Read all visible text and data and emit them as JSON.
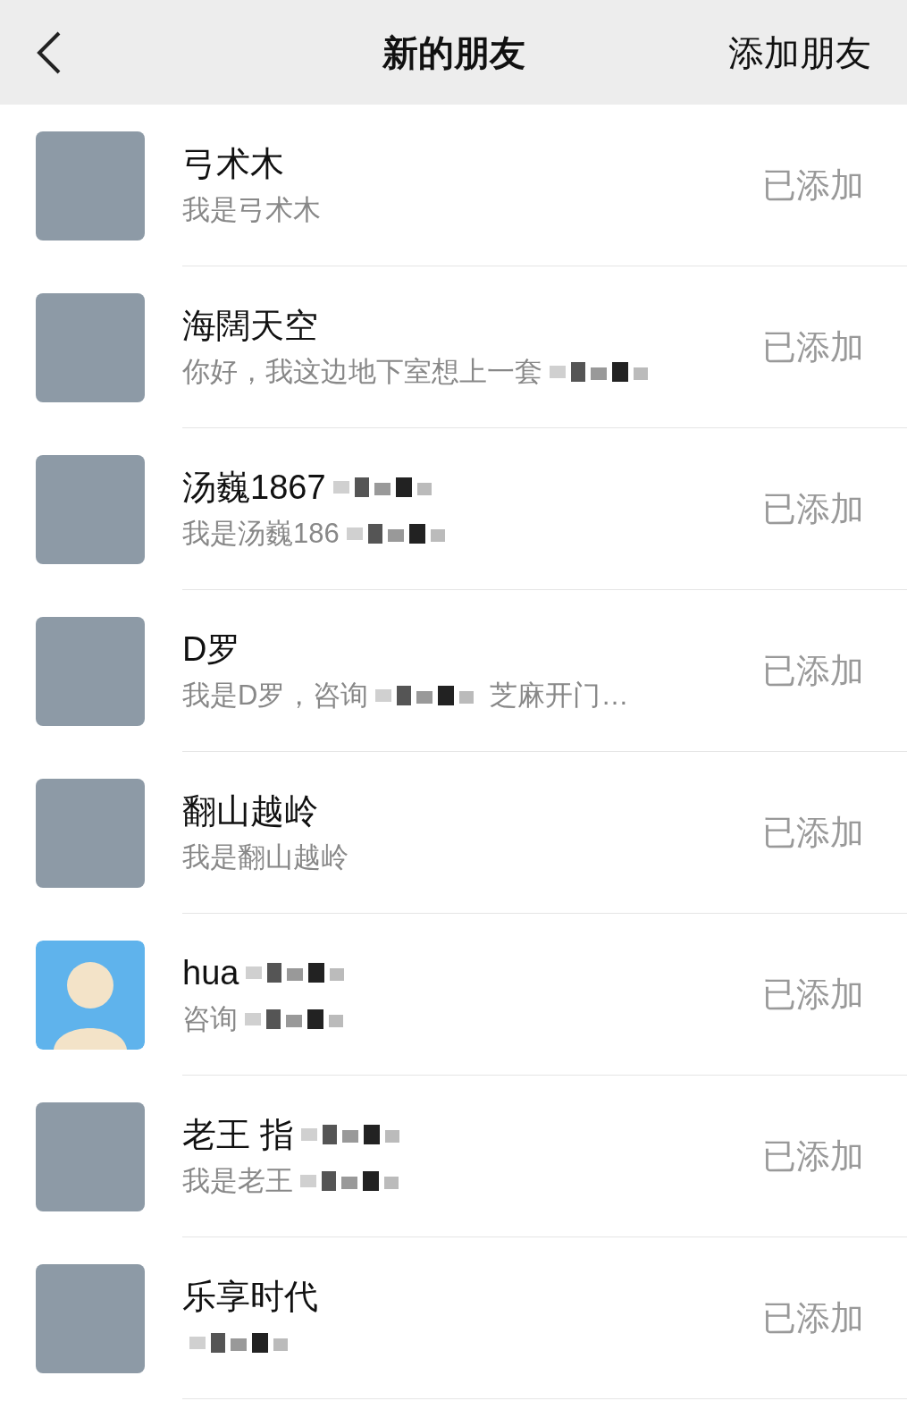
{
  "header": {
    "title": "新的朋友",
    "action": "添加朋友"
  },
  "items": [
    {
      "kind": "photo",
      "name": [
        {
          "kind": "text",
          "text": "弓术木"
        }
      ],
      "message": [
        {
          "kind": "text",
          "text": "我是弓术木"
        }
      ],
      "status": "已添加"
    },
    {
      "kind": "photo",
      "name": [
        {
          "kind": "text",
          "text": "海闊天空"
        }
      ],
      "message": [
        {
          "kind": "text",
          "text": "你好，我这边地下室想上一套"
        },
        {
          "kind": "mosaic"
        }
      ],
      "status": "已添加"
    },
    {
      "kind": "photo",
      "name": [
        {
          "kind": "text",
          "text": "汤巍1867"
        },
        {
          "kind": "mosaic"
        }
      ],
      "message": [
        {
          "kind": "text",
          "text": "我是汤巍186"
        },
        {
          "kind": "mosaic"
        }
      ],
      "status": "已添加"
    },
    {
      "kind": "photo",
      "name": [
        {
          "kind": "text",
          "text": "D罗"
        }
      ],
      "message": [
        {
          "kind": "text",
          "text": "我是D罗，咨询"
        },
        {
          "kind": "mosaic"
        },
        {
          "kind": "text",
          "text": "芝麻开门…"
        }
      ],
      "status": "已添加"
    },
    {
      "kind": "photo",
      "name": [
        {
          "kind": "text",
          "text": "翻山越岭"
        }
      ],
      "message": [
        {
          "kind": "text",
          "text": "我是翻山越岭"
        }
      ],
      "status": "已添加"
    },
    {
      "kind": "cartoon",
      "name": [
        {
          "kind": "text",
          "text": "hua"
        },
        {
          "kind": "mosaic"
        }
      ],
      "message": [
        {
          "kind": "text",
          "text": "咨询"
        },
        {
          "kind": "mosaic"
        }
      ],
      "status": "已添加"
    },
    {
      "kind": "photo",
      "name": [
        {
          "kind": "text",
          "text": "老王 指"
        },
        {
          "kind": "mosaic"
        }
      ],
      "message": [
        {
          "kind": "text",
          "text": "我是老王"
        },
        {
          "kind": "mosaic"
        }
      ],
      "status": "已添加"
    },
    {
      "kind": "photo",
      "name": [
        {
          "kind": "text",
          "text": "乐享时代"
        }
      ],
      "message": [
        {
          "kind": "mosaic"
        }
      ],
      "status": "已添加"
    }
  ]
}
